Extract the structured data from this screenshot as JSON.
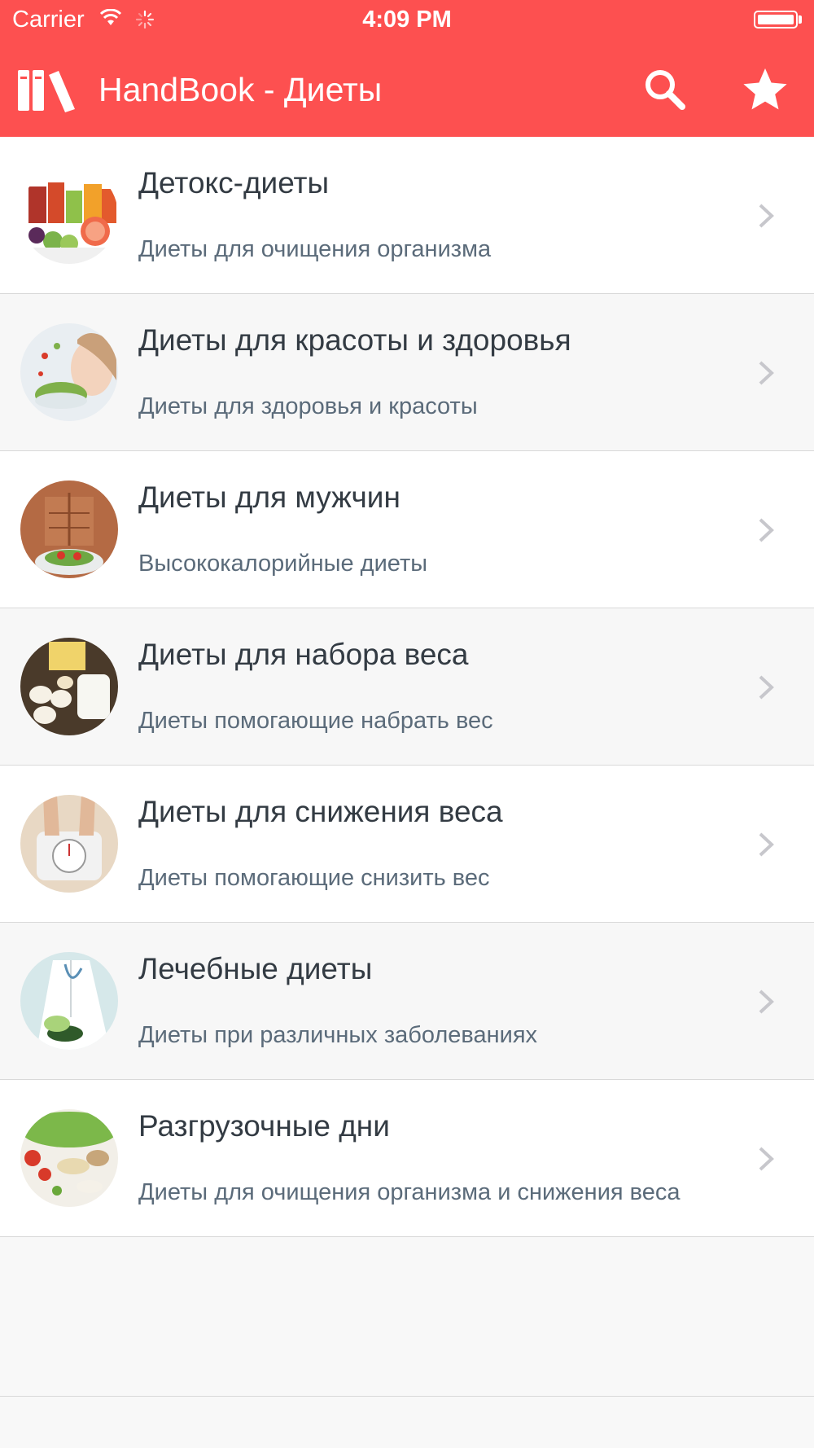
{
  "status_bar": {
    "carrier": "Carrier",
    "time": "4:09 PM"
  },
  "nav": {
    "title": "HandBook - Диеты",
    "icons": [
      "books-icon",
      "search-icon",
      "star-icon"
    ],
    "color": "#fd5050"
  },
  "diets": [
    {
      "title": "Детокс-диеты",
      "subtitle": "Диеты для очищения организма",
      "thumb_icon": "juice-fruits-image"
    },
    {
      "title": "Диеты для красоты и здоровья",
      "subtitle": "Диеты для здоровья и красоты",
      "thumb_icon": "woman-salad-image"
    },
    {
      "title": "Диеты для мужчин",
      "subtitle": "Высококалорийные диеты",
      "thumb_icon": "abs-salad-image"
    },
    {
      "title": "Диеты для набора веса",
      "subtitle": "Диеты помогающие набрать вес",
      "thumb_icon": "dairy-eggs-image"
    },
    {
      "title": "Диеты для снижения веса",
      "subtitle": "Диеты помогающие снизить вес",
      "thumb_icon": "scale-feet-image"
    },
    {
      "title": "Лечебные диеты",
      "subtitle": "Диеты при различных заболеваниях",
      "thumb_icon": "doctor-vegetables-image"
    },
    {
      "title": "Разгрузочные дни",
      "subtitle": "Диеты для очищения организма и снижения веса",
      "thumb_icon": "vegetables-table-image"
    }
  ]
}
